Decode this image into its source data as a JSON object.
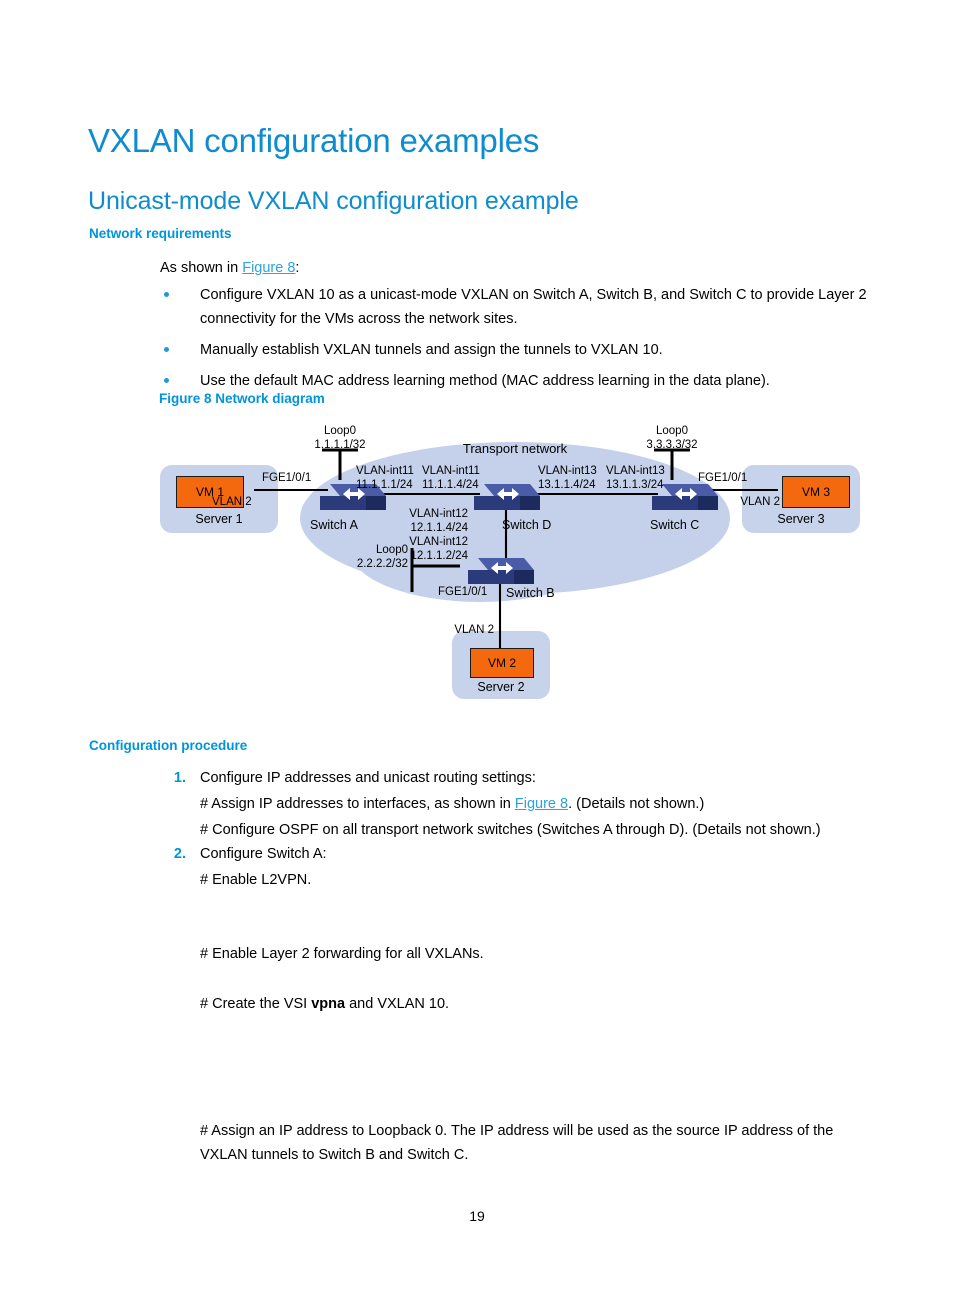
{
  "document": {
    "title": "VXLAN configuration examples",
    "subtitle": "Unicast-mode VXLAN configuration example",
    "page_number": "19"
  },
  "network_requirements": {
    "heading": "Network requirements",
    "lead_prefix": "As shown in ",
    "lead_link": "Figure 8",
    "lead_suffix": ":",
    "bullets": [
      "Configure VXLAN 10 as a unicast-mode VXLAN on Switch A, Switch B, and Switch C to provide Layer 2 connectivity for the VMs across the network sites.",
      "Manually establish VXLAN tunnels and assign the tunnels to VXLAN 10.",
      "Use the default MAC address learning method (MAC address learning in the data plane)."
    ]
  },
  "figure": {
    "caption": "Figure 8 Network diagram",
    "cloud_label": "Transport network",
    "colors": {
      "cloud": "#c5d1ea",
      "server": "#c6d3ea",
      "vm": "#f4690d",
      "switch_body": "#2b3a7a",
      "switch_top": "#4a5ba8",
      "link": "#000000"
    },
    "servers": [
      {
        "id": "server-1",
        "name": "Server 1",
        "vm": "VM 1",
        "vlan": "VLAN 2"
      },
      {
        "id": "server-2",
        "name": "Server 2",
        "vm": "VM 2",
        "vlan": "VLAN 2"
      },
      {
        "id": "server-3",
        "name": "Server 3",
        "vm": "VM 3",
        "vlan": "VLAN 2"
      }
    ],
    "switches": [
      {
        "id": "switch-a",
        "name": "Switch A"
      },
      {
        "id": "switch-b",
        "name": "Switch B"
      },
      {
        "id": "switch-c",
        "name": "Switch C"
      },
      {
        "id": "switch-d",
        "name": "Switch D"
      }
    ],
    "loopbacks": [
      {
        "id": "loop0-a",
        "label": "Loop0",
        "address": "1.1.1.1/32"
      },
      {
        "id": "loop0-b",
        "label": "Loop0",
        "address": "2.2.2.2/32"
      },
      {
        "id": "loop0-c",
        "label": "Loop0",
        "address": "3.3.3.3/32"
      }
    ],
    "access_ports": [
      {
        "id": "fge-a",
        "label": "FGE1/0/1"
      },
      {
        "id": "fge-b",
        "label": "FGE1/0/1"
      },
      {
        "id": "fge-c",
        "label": "FGE1/0/1"
      }
    ],
    "interfaces": [
      {
        "id": "int-a-11",
        "name": "VLAN-int11",
        "address": "11.1.1.1/24"
      },
      {
        "id": "int-d-11",
        "name": "VLAN-int11",
        "address": "11.1.1.4/24"
      },
      {
        "id": "int-d-13",
        "name": "VLAN-int13",
        "address": "13.1.1.4/24"
      },
      {
        "id": "int-c-13",
        "name": "VLAN-int13",
        "address": "13.1.1.3/24"
      },
      {
        "id": "int-d-12",
        "name": "VLAN-int12",
        "address": "12.1.1.4/24"
      },
      {
        "id": "int-b-12",
        "name": "VLAN-int12",
        "address": "12.1.1.2/24"
      }
    ]
  },
  "configuration_procedure": {
    "heading": "Configuration procedure",
    "steps": [
      {
        "num": "1.",
        "text": "Configure IP addresses and unicast routing settings:",
        "lines": [
          {
            "prefix": "# Assign IP addresses to interfaces, as shown in ",
            "link": "Figure 8",
            "suffix": ". (Details not shown.)"
          },
          {
            "prefix": "# Configure OSPF on all transport network switches (Switches A through D). (Details not shown.)",
            "link": "",
            "suffix": ""
          }
        ]
      },
      {
        "num": "2.",
        "text": "Configure Switch A:",
        "lines": [
          {
            "prefix": "# Enable L2VPN.",
            "link": "",
            "suffix": ""
          },
          {
            "prefix": "# Enable Layer 2 forwarding for all VXLANs.",
            "link": "",
            "suffix": ""
          },
          {
            "prefix": "# Create the VSI ",
            "bold": "vpna",
            "suffix2": " and VXLAN 10."
          }
        ]
      }
    ],
    "tail_paragraph": "# Assign an IP address to Loopback 0. The IP address will be used as the source IP address of the VXLAN tunnels to Switch B and Switch C."
  }
}
